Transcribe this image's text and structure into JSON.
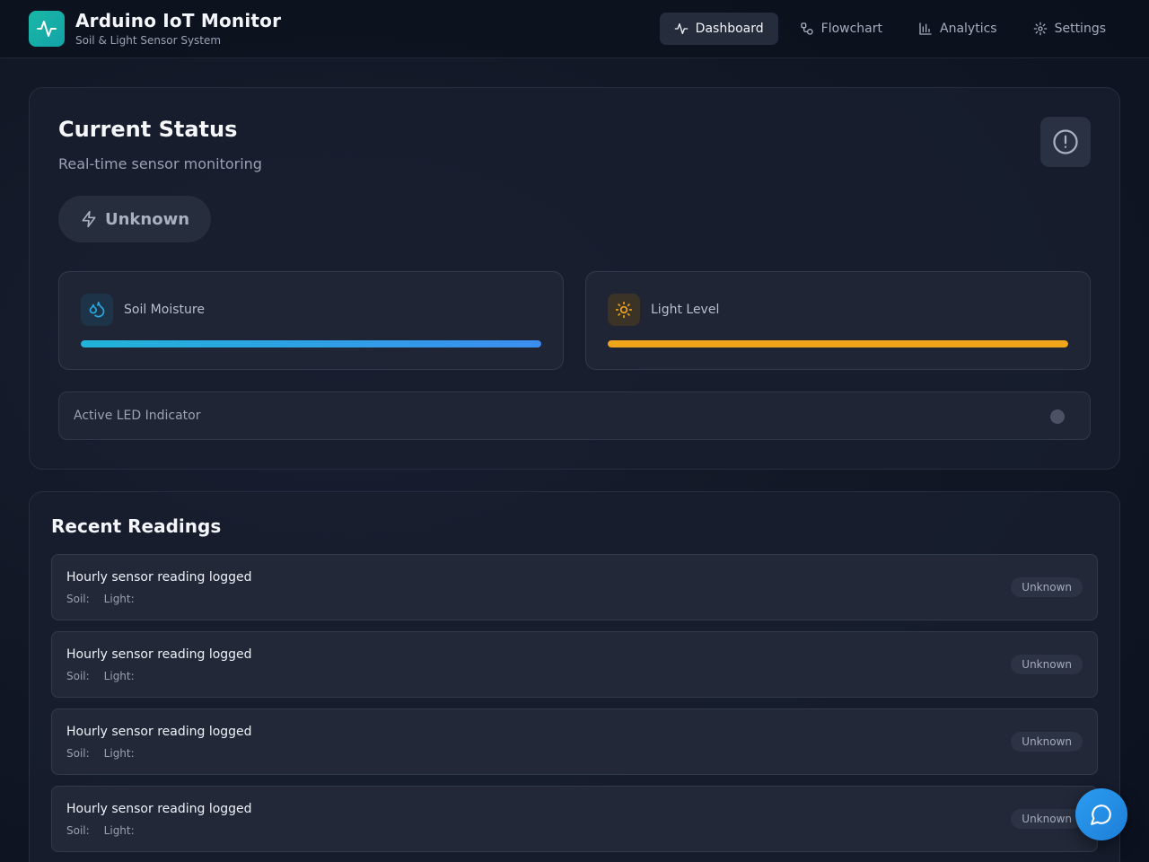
{
  "app": {
    "title": "Arduino IoT Monitor",
    "subtitle": "Soil & Light Sensor System",
    "icon": "activity-pulse-icon",
    "accent": "#19b7a6"
  },
  "nav": {
    "items": [
      {
        "label": "Dashboard",
        "icon": "activity-icon",
        "active": true
      },
      {
        "label": "Flowchart",
        "icon": "workflow-icon",
        "active": false
      },
      {
        "label": "Analytics",
        "icon": "bar-chart-icon",
        "active": false
      },
      {
        "label": "Settings",
        "icon": "gear-icon",
        "active": false
      }
    ]
  },
  "status": {
    "title": "Current Status",
    "subtitle": "Real-time sensor monitoring",
    "state_label": "Unknown",
    "state_icon": "lightning-icon",
    "alert_icon": "alert-circle-icon",
    "soil": {
      "label": "Soil Moisture",
      "icon": "droplets-icon",
      "color": "#2aa8e0",
      "level": 1.0
    },
    "light": {
      "label": "Light Level",
      "icon": "sun-icon",
      "color": "#f0a51a",
      "level": 1.0
    },
    "led": {
      "label": "Active LED Indicator",
      "color": "#4a5263"
    }
  },
  "readings": {
    "title": "Recent Readings",
    "items": [
      {
        "title": "Hourly sensor reading logged",
        "soil_label": "Soil:",
        "light_label": "Light:",
        "badge": "Unknown"
      },
      {
        "title": "Hourly sensor reading logged",
        "soil_label": "Soil:",
        "light_label": "Light:",
        "badge": "Unknown"
      },
      {
        "title": "Hourly sensor reading logged",
        "soil_label": "Soil:",
        "light_label": "Light:",
        "badge": "Unknown"
      },
      {
        "title": "Hourly sensor reading logged",
        "soil_label": "Soil:",
        "light_label": "Light:",
        "badge": "Unknown"
      }
    ]
  },
  "chat": {
    "icon": "chat-bubble-icon"
  }
}
